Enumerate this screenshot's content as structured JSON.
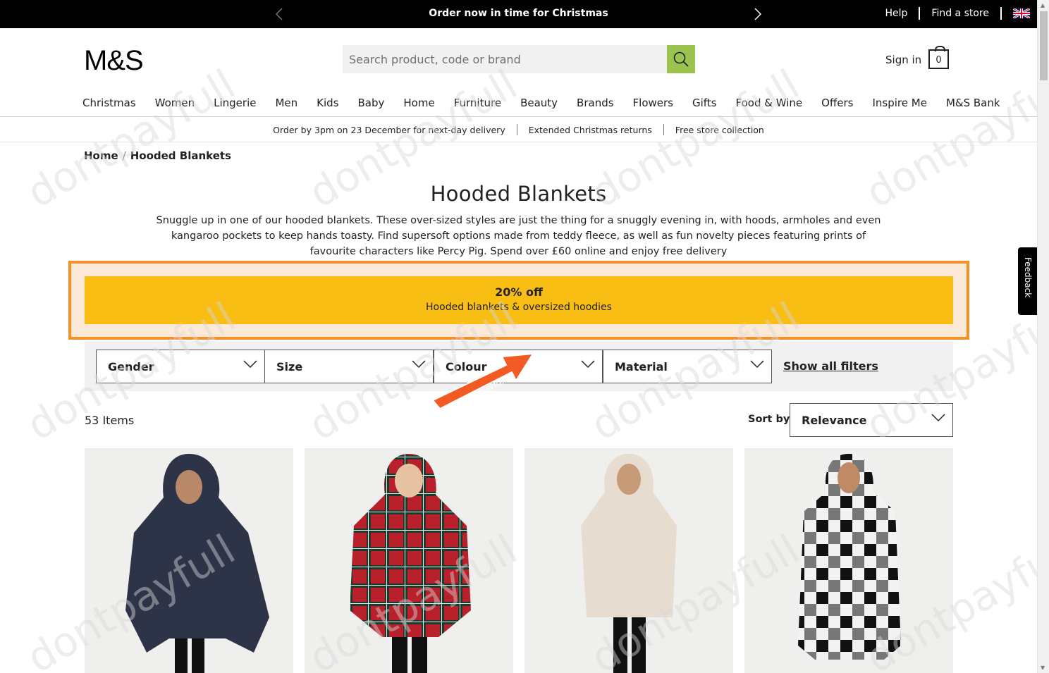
{
  "topbar": {
    "promo": "Order now in time for Christmas",
    "help": "Help",
    "find_store": "Find a store"
  },
  "header": {
    "logo": "M&S",
    "search_placeholder": "Search product, code or brand",
    "sign_in": "Sign in",
    "bag_count": "0"
  },
  "nav": [
    "Christmas",
    "Women",
    "Lingerie",
    "Men",
    "Kids",
    "Baby",
    "Home",
    "Furniture",
    "Beauty",
    "Brands",
    "Flowers",
    "Gifts",
    "Food & Wine",
    "Offers",
    "Inspire Me",
    "M&S Bank"
  ],
  "delivery": [
    "Order by 3pm on 23 December for next-day delivery",
    "Extended Christmas returns",
    "Free store collection"
  ],
  "breadcrumb": {
    "home": "Home",
    "sep": "/",
    "current": "Hooded Blankets"
  },
  "page": {
    "title": "Hooded Blankets",
    "description": "Snuggle up in one of our hooded blankets. These over-sized styles are just the thing for a snuggly evening in, with hoods, armholes and even kangaroo pockets to keep hands toasty. Find supersoft options made from teddy fleece, as well as fun novelty pieces featuring prints of favourite characters like Percy Pig. Spend over £60 online and enjoy free delivery"
  },
  "offer": {
    "headline": "20% off",
    "subline": "Hooded blankets & oversized hoodies"
  },
  "filters": [
    "Gender",
    "Size",
    "Colour",
    "Material"
  ],
  "show_all_filters": "Show all filters",
  "results": {
    "count": "53 Items",
    "sort_label": "Sort by",
    "sort_value": "Relevance"
  },
  "feedback": "Feedback",
  "watermark": "dontpayfull",
  "colors": {
    "offer": "#f8be14",
    "offer_outline": "#f3902a",
    "search_button": "#9bc34f"
  }
}
